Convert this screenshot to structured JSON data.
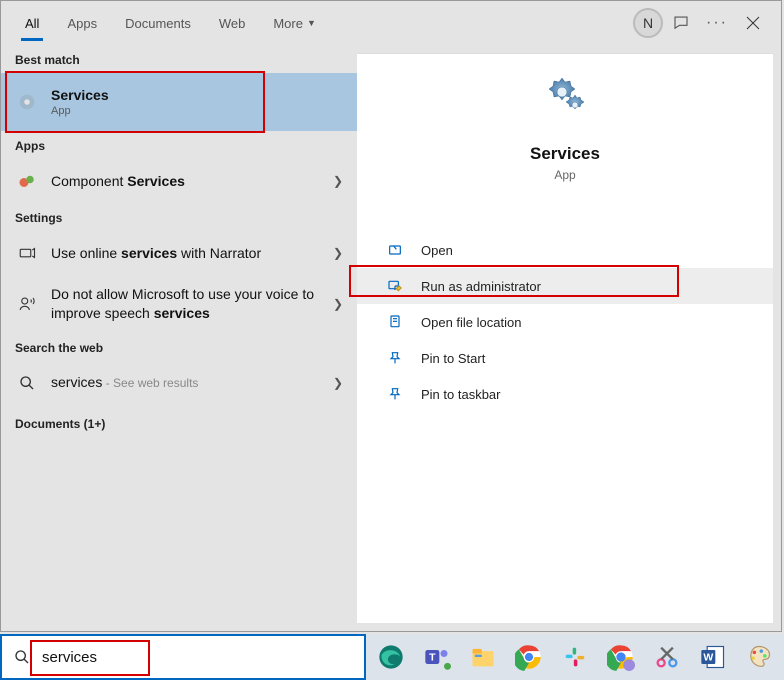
{
  "tabs": {
    "all": "All",
    "apps": "Apps",
    "documents": "Documents",
    "web": "Web",
    "more": "More"
  },
  "avatar_initial": "N",
  "sections": {
    "best_match": "Best match",
    "apps": "Apps",
    "settings": "Settings",
    "search_web": "Search the web",
    "documents": "Documents (1+)"
  },
  "best_match": {
    "title": "Services",
    "subtitle": "App"
  },
  "apps_result": {
    "prefix": "Component ",
    "bold": "Services"
  },
  "settings_results": [
    {
      "prefix": "Use online ",
      "bold": "services",
      "suffix": " with Narrator"
    },
    {
      "prefix": "Do not allow Microsoft to use your voice to improve speech ",
      "bold": "services",
      "suffix": ""
    }
  ],
  "web_result": {
    "term": "services",
    "hint": " - See web results"
  },
  "detail": {
    "title": "Services",
    "subtitle": "App"
  },
  "actions": {
    "open": "Open",
    "run_admin": "Run as administrator",
    "open_location": "Open file location",
    "pin_start": "Pin to Start",
    "pin_taskbar": "Pin to taskbar"
  },
  "search": {
    "value": "services"
  }
}
